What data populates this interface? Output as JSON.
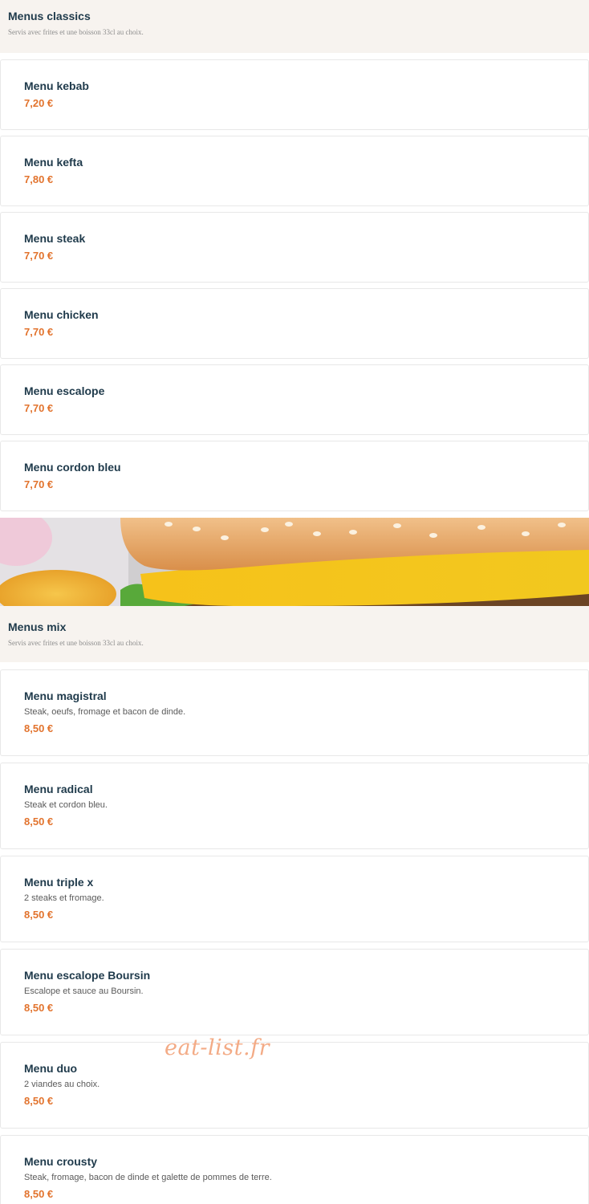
{
  "sections": [
    {
      "title": "Menus classics",
      "subtitle": "Servis avec frites et une boisson 33cl au choix.",
      "items": [
        {
          "name": "Menu kebab",
          "price": "7,20 €"
        },
        {
          "name": "Menu kefta",
          "price": "7,80 €"
        },
        {
          "name": "Menu steak",
          "price": "7,70 €"
        },
        {
          "name": "Menu chicken",
          "price": "7,70 €"
        },
        {
          "name": "Menu escalope",
          "price": "7,70 €"
        },
        {
          "name": "Menu cordon bleu",
          "price": "7,70 €"
        }
      ]
    },
    {
      "title": "Menus mix",
      "subtitle": "Servis avec frites et une boisson 33cl au choix.",
      "items": [
        {
          "name": "Menu magistral",
          "description": "Steak, oeufs, fromage et bacon de dinde.",
          "price": "8,50 €"
        },
        {
          "name": "Menu radical",
          "description": "Steak et cordon bleu.",
          "price": "8,50 €"
        },
        {
          "name": "Menu triple x",
          "description": "2 steaks et fromage.",
          "price": "8,50 €"
        },
        {
          "name": "Menu escalope Boursin",
          "description": "Escalope et sauce au Boursin.",
          "price": "8,50 €"
        },
        {
          "name": "Menu duo",
          "description": "2 viandes au choix.",
          "price": "8,50 €"
        },
        {
          "name": "Menu crousty",
          "description": "Steak, fromage, bacon de dinde et galette de pommes de terre.",
          "price": "8,50 €"
        }
      ]
    }
  ],
  "banner": {
    "icon": "burger-photo"
  },
  "watermark": "eat-list.fr",
  "colors": {
    "accent_price": "#e2732d",
    "title": "#1f3a4b",
    "header_bg": "#f7f3ef"
  }
}
